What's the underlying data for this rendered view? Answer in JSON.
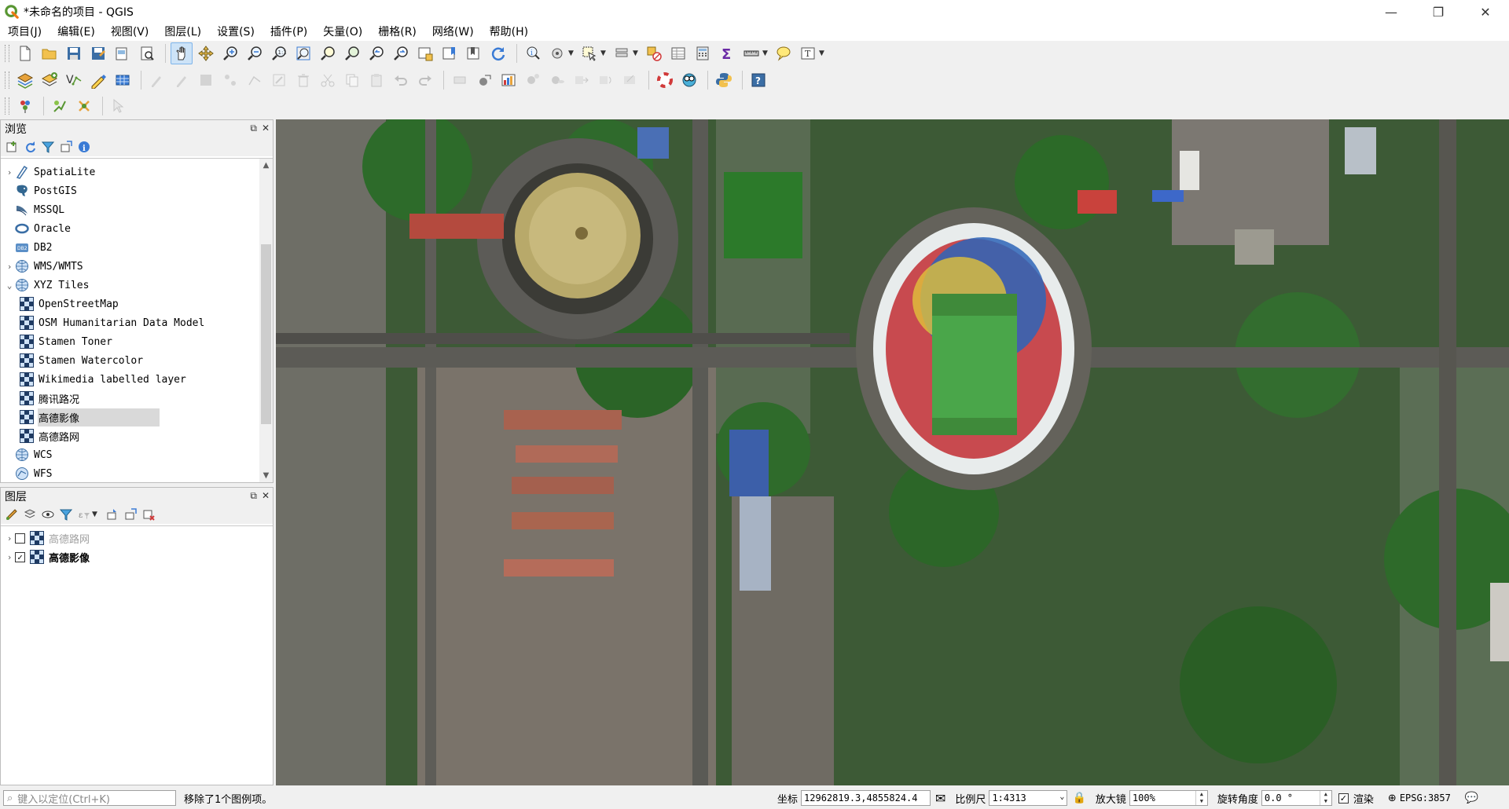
{
  "window": {
    "title": "*未命名的项目 - QGIS",
    "minimize_icon": "minimize-icon",
    "maximize_icon": "restore-icon",
    "close_icon": "close-icon"
  },
  "menu": [
    "项目(J)",
    "编辑(E)",
    "视图(V)",
    "图层(L)",
    "设置(S)",
    "插件(P)",
    "矢量(O)",
    "栅格(R)",
    "网络(W)",
    "帮助(H)"
  ],
  "browser_panel": {
    "title": "浏览",
    "items": [
      {
        "label": "SpatiaLite",
        "icon": "spatialite-icon",
        "expandable": true,
        "indent": 0
      },
      {
        "label": "PostGIS",
        "icon": "postgis-icon",
        "expandable": false,
        "indent": 0
      },
      {
        "label": "MSSQL",
        "icon": "mssql-icon",
        "expandable": false,
        "indent": 0
      },
      {
        "label": "Oracle",
        "icon": "oracle-icon",
        "expandable": false,
        "indent": 0
      },
      {
        "label": "DB2",
        "icon": "db2-icon",
        "expandable": false,
        "indent": 0
      },
      {
        "label": "WMS/WMTS",
        "icon": "wms-globe-icon",
        "expandable": true,
        "indent": 0
      },
      {
        "label": "XYZ Tiles",
        "icon": "xyz-globe-icon",
        "expandable": true,
        "expanded": true,
        "indent": 0
      },
      {
        "label": "OpenStreetMap",
        "icon": "xyz-tile-icon",
        "indent": 1
      },
      {
        "label": "OSM Humanitarian Data Model",
        "icon": "xyz-tile-icon",
        "indent": 1
      },
      {
        "label": "Stamen Toner",
        "icon": "xyz-tile-icon",
        "indent": 1
      },
      {
        "label": "Stamen Watercolor",
        "icon": "xyz-tile-icon",
        "indent": 1
      },
      {
        "label": "Wikimedia labelled layer",
        "icon": "xyz-tile-icon",
        "indent": 1
      },
      {
        "label": "腾讯路况",
        "icon": "xyz-tile-icon",
        "indent": 1
      },
      {
        "label": "高德影像",
        "icon": "xyz-tile-icon",
        "indent": 1,
        "selected": true
      },
      {
        "label": "高德路网",
        "icon": "xyz-tile-icon",
        "indent": 1
      },
      {
        "label": "WCS",
        "icon": "wcs-globe-icon",
        "expandable": false,
        "indent": 0
      },
      {
        "label": "WFS",
        "icon": "wfs-icon",
        "expandable": false,
        "indent": 0
      }
    ]
  },
  "layers_panel": {
    "title": "图层",
    "layers": [
      {
        "label": "高德路网",
        "checked": false
      },
      {
        "label": "高德影像",
        "checked": true
      }
    ]
  },
  "statusbar": {
    "locator_placeholder": "键入以定位(Ctrl+K)",
    "message": "移除了1个图例项。",
    "coordinate_label": "坐标",
    "coordinate_value": "12962819.3,4855824.4",
    "scale_label": "比例尺",
    "scale_value": "1:4313",
    "magnifier_label": "放大镜",
    "magnifier_value": "100%",
    "rotation_label": "旋转角度",
    "rotation_value": "0.0 °",
    "render_label": "渲染",
    "crs_value": "EPSG:3857"
  },
  "colors": {
    "accent": "#3a7bd5",
    "qgis_green": "#589632",
    "map_bg": "#2f4a2c"
  }
}
